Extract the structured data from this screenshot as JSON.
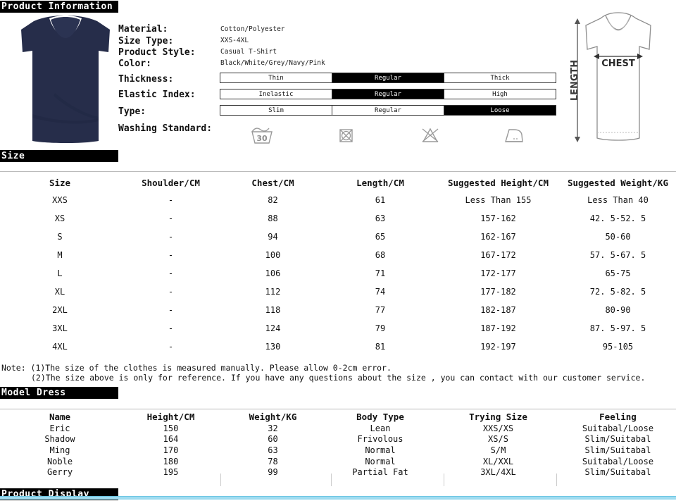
{
  "sections": {
    "product_information": "Product Information",
    "size": "Size",
    "model_dress": "Model Dress",
    "product_display": "Product Display"
  },
  "product": {
    "photo_color": "#262d4a",
    "attributes": [
      {
        "label": "Material:",
        "value": "Cotton/Polyester"
      },
      {
        "label": "Size Type:",
        "value": "XXS-4XL"
      },
      {
        "label": "Product Style:",
        "value": "Casual T-Shirt"
      },
      {
        "label": "Color:",
        "value": "Black/White/Grey/Navy/Pink"
      }
    ],
    "option_bars": [
      {
        "label": "Thickness:",
        "options": [
          "Thin",
          "Regular",
          "Thick"
        ],
        "selected": 1
      },
      {
        "label": "Elastic Index:",
        "options": [
          "Inelastic",
          "Regular",
          "High"
        ],
        "selected": 1
      },
      {
        "label": "Type:",
        "options": [
          "Slim",
          "Regular",
          "Loose"
        ],
        "selected": 2
      }
    ],
    "washing_label": "Washing Standard:",
    "washing_symbols": [
      {
        "name": "wash-30-icon",
        "temperature": "30"
      },
      {
        "name": "no-tumble-dry-icon",
        "temperature": ""
      },
      {
        "name": "no-bleach-icon",
        "temperature": ""
      },
      {
        "name": "iron-icon",
        "temperature": ""
      }
    ]
  },
  "diagram": {
    "length_label": "LENGTH",
    "chest_label": "CHEST"
  },
  "size_table": {
    "headers": [
      "Size",
      "Shoulder/CM",
      "Chest/CM",
      "Length/CM",
      "Suggested Height/CM",
      "Suggested Weight/KG"
    ],
    "rows": [
      [
        "XXS",
        "-",
        "82",
        "61",
        "Less Than 155",
        "Less Than 40"
      ],
      [
        "XS",
        "-",
        "88",
        "63",
        "157-162",
        "42. 5-52. 5"
      ],
      [
        "S",
        "-",
        "94",
        "65",
        "162-167",
        "50-60"
      ],
      [
        "M",
        "-",
        "100",
        "68",
        "167-172",
        "57. 5-67. 5"
      ],
      [
        "L",
        "-",
        "106",
        "71",
        "172-177",
        "65-75"
      ],
      [
        "XL",
        "-",
        "112",
        "74",
        "177-182",
        "72. 5-82. 5"
      ],
      [
        "2XL",
        "-",
        "118",
        "77",
        "182-187",
        "80-90"
      ],
      [
        "3XL",
        "-",
        "124",
        "79",
        "187-192",
        "87. 5-97. 5"
      ],
      [
        "4XL",
        "-",
        "130",
        "81",
        "192-197",
        "95-105"
      ]
    ]
  },
  "notes": {
    "line1": "Note: (1)The size of the clothes is measured manually. Please allow 0-2cm error.",
    "line2": "(2)The size above is only for reference. If you have any questions about the size , you can contact with our customer service."
  },
  "model_table": {
    "headers": [
      "Name",
      "Height/CM",
      "Weight/KG",
      "Body Type",
      "Trying Size",
      "Feeling"
    ],
    "rows": [
      [
        "Eric",
        "150",
        "32",
        "Lean",
        "XXS/XS",
        "Suitabal/Loose"
      ],
      [
        "Shadow",
        "164",
        "60",
        "Frivolous",
        "XS/S",
        "Slim/Suitabal"
      ],
      [
        "Ming",
        "170",
        "63",
        "Normal",
        "S/M",
        "Slim/Suitabal"
      ],
      [
        "Noble",
        "180",
        "78",
        "Normal",
        "XL/XXL",
        "Suitabal/Loose"
      ],
      [
        "Gerry",
        "195",
        "99",
        "Partial Fat",
        "3XL/4XL",
        "Slim/Suitabal"
      ]
    ]
  },
  "colors": {
    "banner_bg": "#000000",
    "banner_text": "#ffffff",
    "accent_cyan": "#9fdcf0",
    "rule": "#b9b9b9"
  }
}
